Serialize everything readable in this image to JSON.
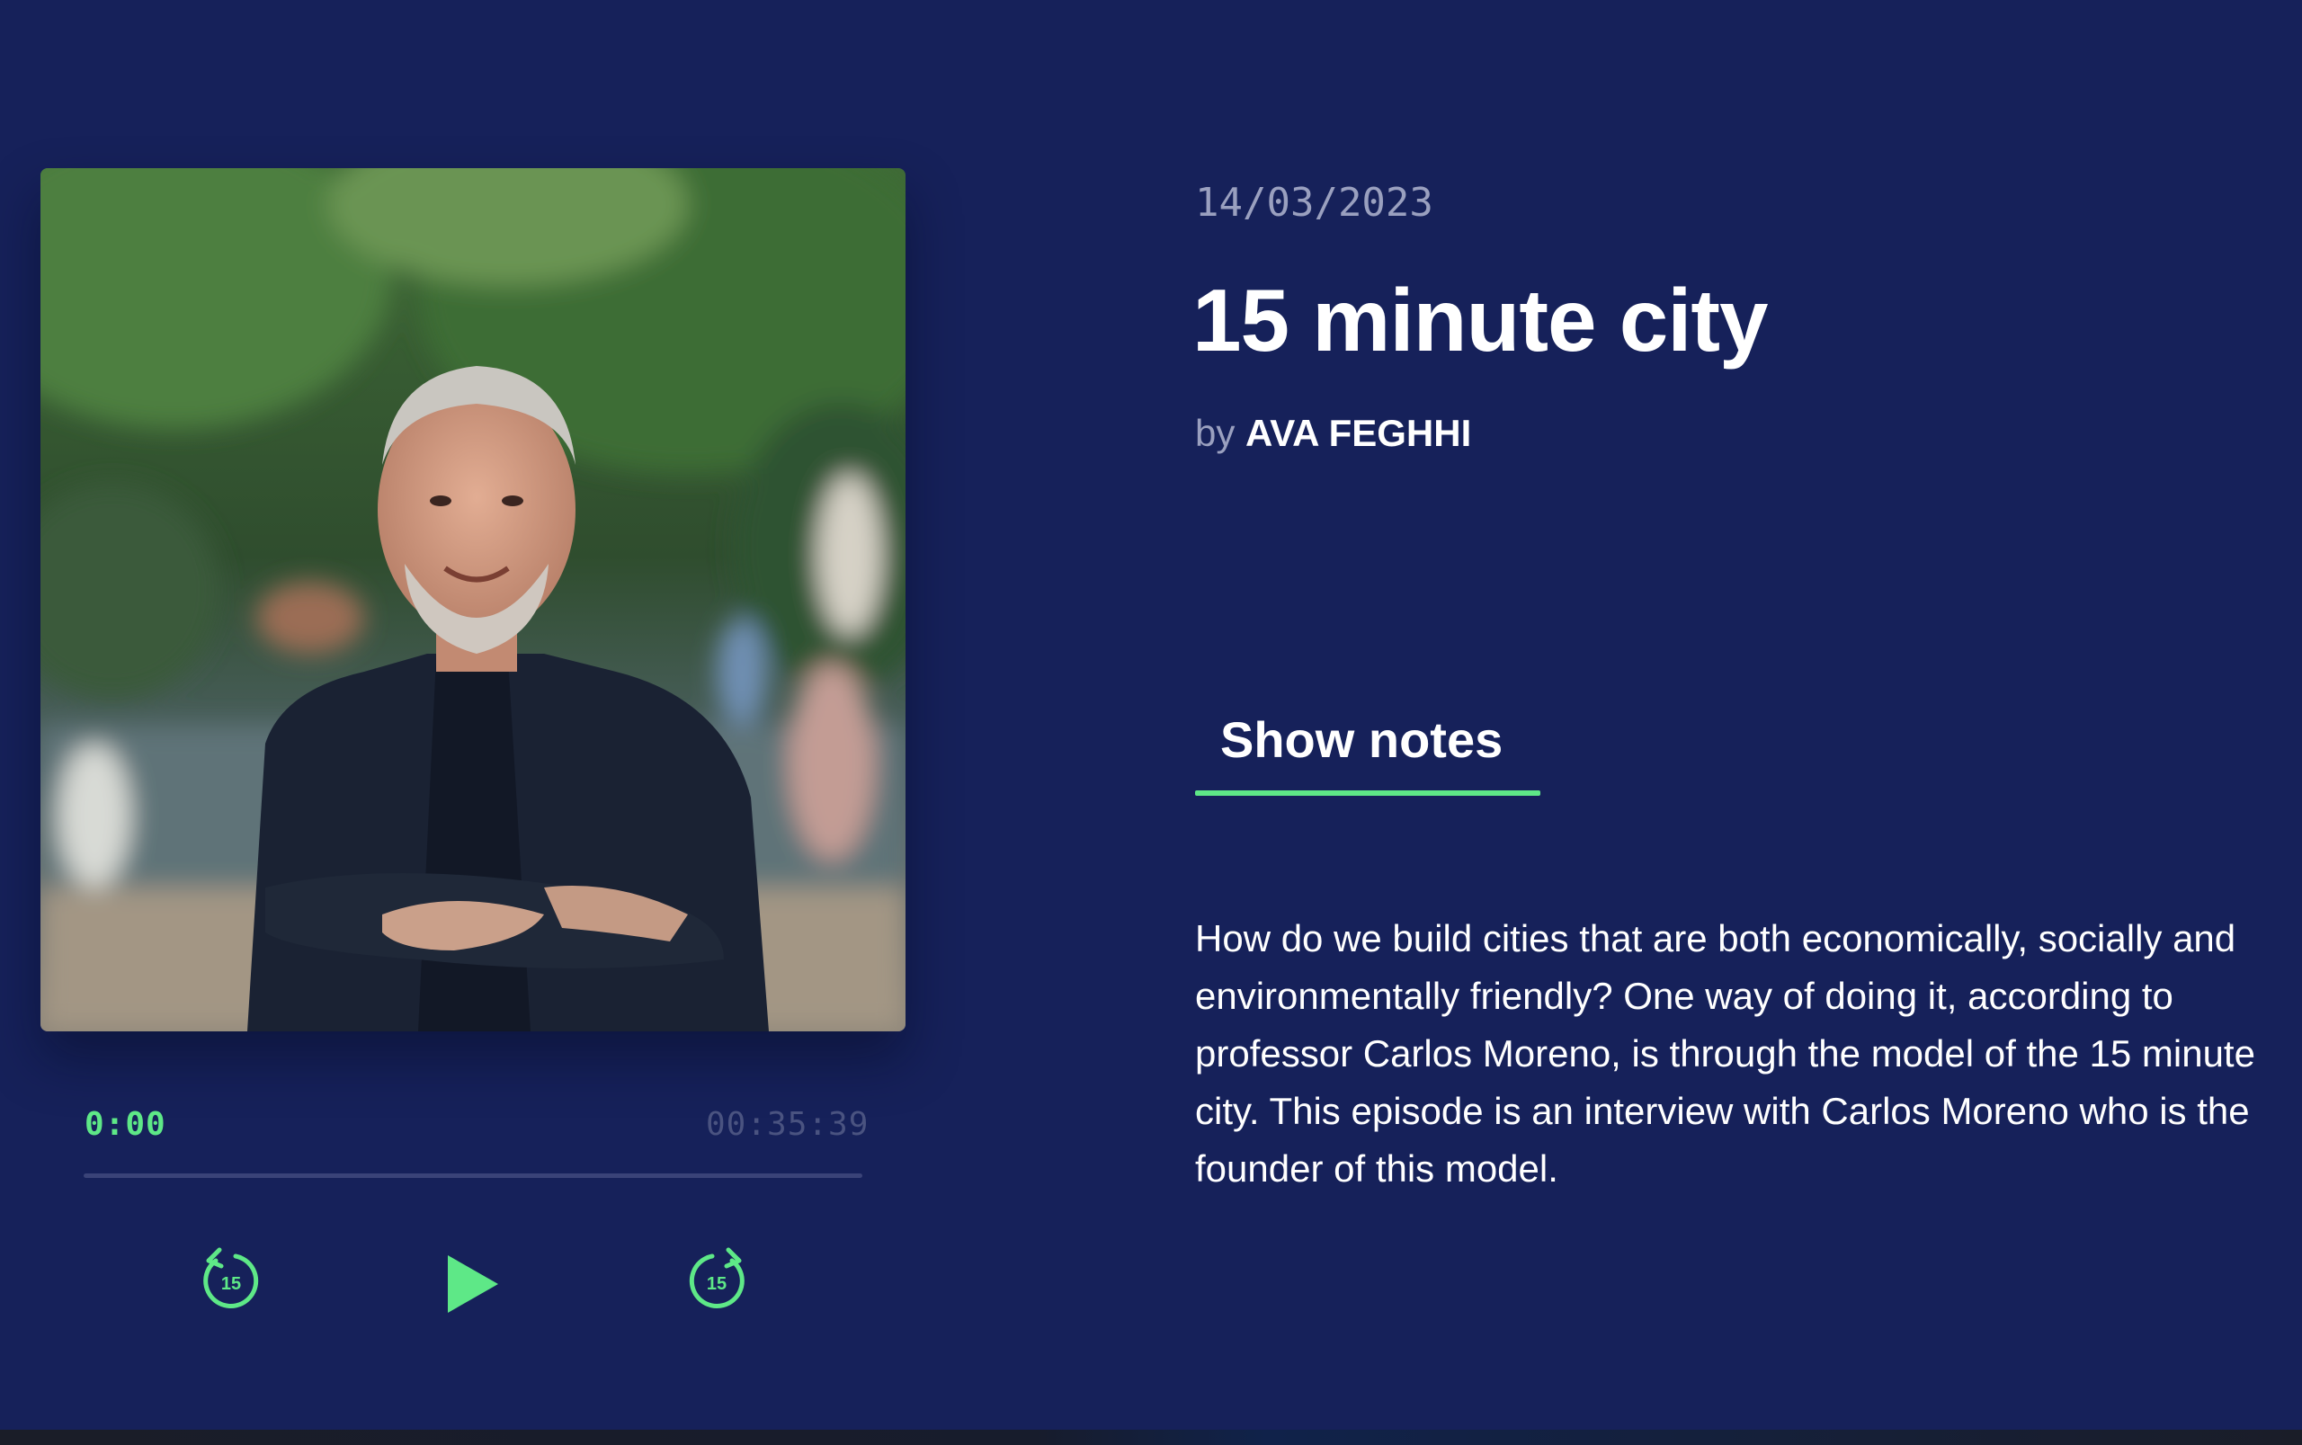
{
  "episode": {
    "date": "14/03/2023",
    "title": "15 minute city",
    "byline_prefix": "by",
    "author": "AVA FEGHHI",
    "cover_alt": "Portrait of a smiling man with arms crossed in a park"
  },
  "player": {
    "current_time": "0:00",
    "total_time": "00:35:39",
    "progress": 0,
    "rewind_seconds": "15",
    "forward_seconds": "15"
  },
  "tabs": [
    {
      "label": "Show notes",
      "active": true
    }
  ],
  "show_notes": "How do we build cities that are both economically, socially and environmentally friendly? One way of doing it, according to professor Carlos Moreno, is through the model of the 15 minute city. This episode is an interview with Carlos Moreno who is the founder of this model.",
  "colors": {
    "background": "#16215a",
    "accent": "#5ee887",
    "muted": "#9aa0bf",
    "track": "#3a4378"
  },
  "icons": {
    "rewind": "rewind-15-icon",
    "play": "play-icon",
    "forward": "forward-15-icon"
  }
}
